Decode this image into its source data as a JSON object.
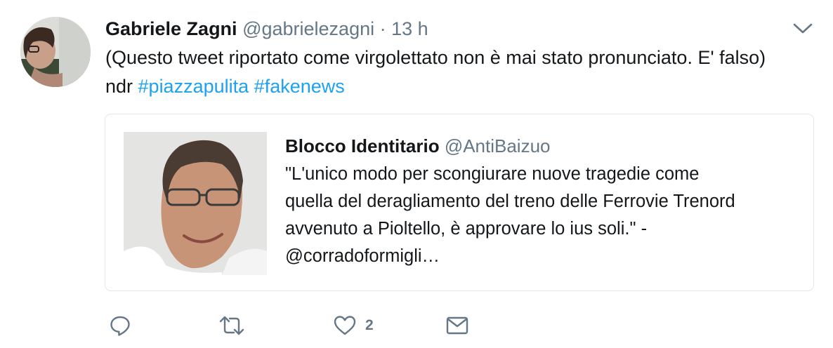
{
  "author": {
    "name": "Gabriele Zagni",
    "handle": "@gabrielezagni",
    "separator": "·",
    "time": "13 h"
  },
  "tweet": {
    "text_line1": "(Questo tweet riportato come virgolettato non è mai stato pronunciato. E' falso)",
    "text_prefix": "ndr ",
    "hashtags": [
      "#piazzapulita",
      "#fakenews"
    ]
  },
  "quoted": {
    "name": "Blocco Identitario",
    "handle": "@AntiBaizuo",
    "lines": [
      "\"L'unico modo per scongiurare nuove tragedie come",
      "quella del deragliamento del treno delle Ferrovie Trenord",
      "avvenuto a Pioltello, è approvare lo ius soli.\" -",
      "@corradoformigli…"
    ]
  },
  "actions": {
    "reply_icon": "reply-icon",
    "retweet_icon": "retweet-icon",
    "like_icon": "heart-icon",
    "like_count": "2",
    "dm_icon": "envelope-icon"
  },
  "colors": {
    "text": "#14171a",
    "muted": "#657786",
    "link": "#1da1f2",
    "border": "#e1e8ed"
  }
}
